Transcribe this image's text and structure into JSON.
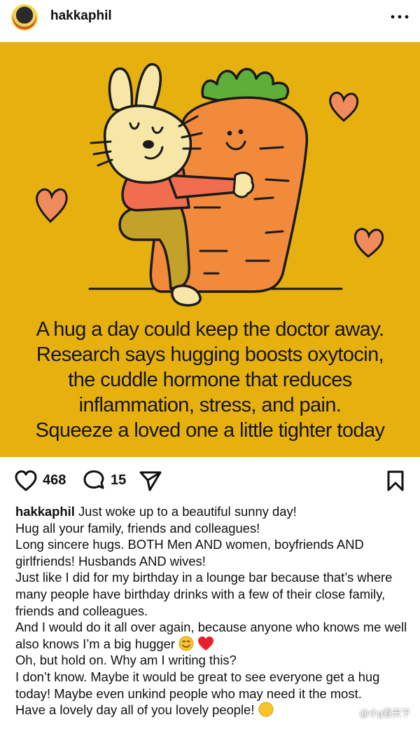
{
  "header": {
    "username": "hakkaphil"
  },
  "post_image": {
    "quote_lines": [
      "A hug a day could keep the doctor away.",
      "Research says hugging boosts oxytocin,",
      "the cuddle hormone that reduces",
      "inflammation, stress, and pain.",
      "Squeeze a loved one a little tighter today"
    ],
    "background_color": "#e6b10f"
  },
  "actions": {
    "likes": "468",
    "comments": "15"
  },
  "caption": {
    "username": "hakkaphil",
    "lines": [
      "Just woke up to a beautiful sunny day!",
      "Hug all your family, friends and colleagues!",
      "Long sincere hugs. BOTH Men AND women, boyfriends AND girlfriends! Husbands AND wives!",
      "Just like I did for my birthday in a lounge bar because that’s where many people have birthday drinks with a few of their close family, friends and colleagues.",
      "And I would do it all over again, because anyone who knows me well also knows I’m a big hugger",
      "Oh, but hold on. Why am I writing this?",
      "I don’t know. Maybe it would be great to see everyone get a hug today! Maybe even unkind people who may need it the most.",
      "Have a lovely day all of you lovely people!"
    ]
  },
  "watermark": "@小g看天下"
}
